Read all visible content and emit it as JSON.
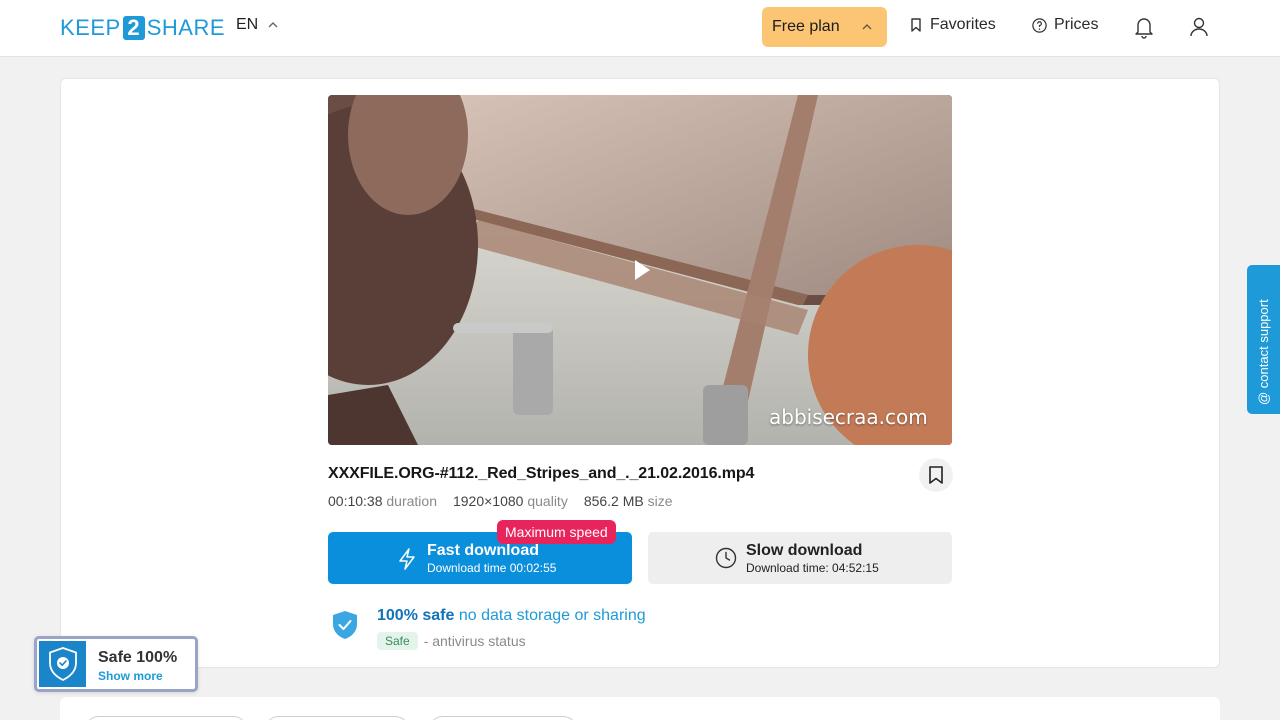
{
  "header": {
    "logo_left": "KEEP",
    "logo_mid": "2",
    "logo_right": "SHARE",
    "language": "EN",
    "plan_label": "Free plan",
    "favorites_label": "Favorites",
    "prices_label": "Prices",
    "icons": [
      "chevron-up-icon",
      "bookmark-icon",
      "help-circle-icon",
      "bell-icon",
      "user-icon"
    ]
  },
  "video": {
    "watermark": "abbisecraa.com",
    "play_icon": "play-icon"
  },
  "file": {
    "title": "XXXFILE.ORG-#112._Red_Stripes_and_._21.02.2016.mp4",
    "duration": "00:10:38",
    "duration_label": "duration",
    "resolution": "1920×1080",
    "resolution_label": "quality",
    "size": "856.2 MB",
    "size_label": "size"
  },
  "downloads": {
    "fast_title": "Fast download",
    "fast_sub": "Download time 00:02:55",
    "fast_badge": "Maximum speed",
    "slow_title": "Slow download",
    "slow_sub": "Download time: 04:52:15"
  },
  "safety": {
    "headline_bold": "100% safe",
    "headline_rest": "no data storage or sharing",
    "status_pill": "Safe",
    "status_text": "- antivirus status"
  },
  "contact_label": "@ contact support",
  "safe_badge": {
    "title": "Safe 100%",
    "link": "Show more"
  },
  "colors": {
    "brand": "#1e9ad8",
    "plan": "#fcc574",
    "fast": "#0a8fdc",
    "badge": "#e8245c"
  }
}
